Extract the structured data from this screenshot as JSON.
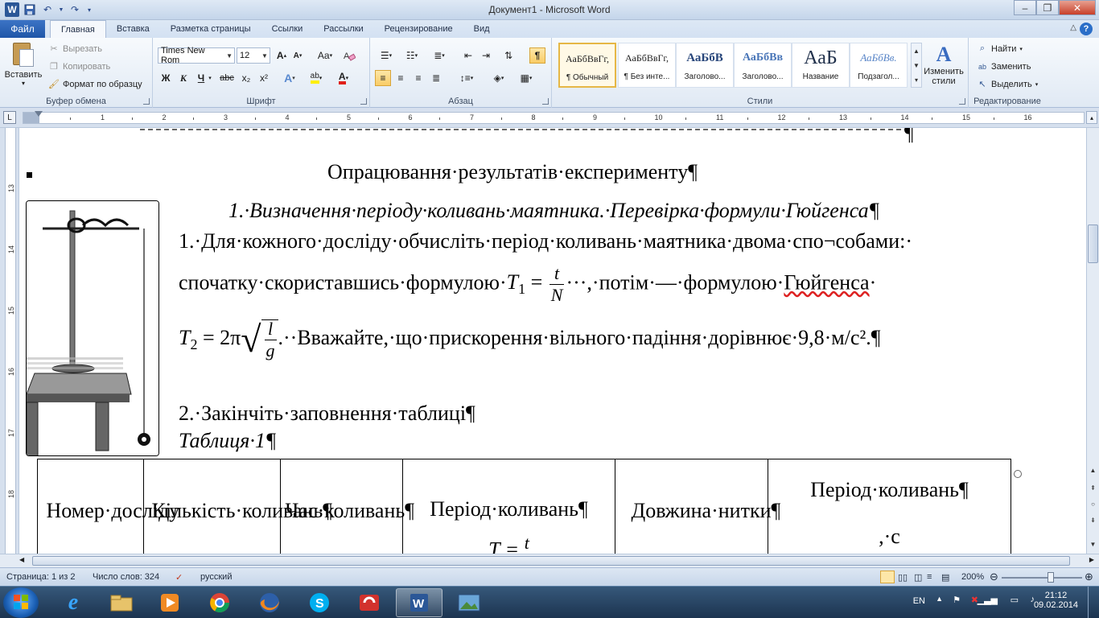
{
  "window": {
    "title": "Документ1 - Microsoft Word"
  },
  "tabs": {
    "file": "Файл",
    "items": [
      "Главная",
      "Вставка",
      "Разметка страницы",
      "Ссылки",
      "Рассылки",
      "Рецензирование",
      "Вид"
    ]
  },
  "clipboard": {
    "paste": "Вставить",
    "cut": "Вырезать",
    "copy": "Копировать",
    "format_painter": "Формат по образцу",
    "label": "Буфер обмена"
  },
  "font": {
    "name": "Times New Rom",
    "size": "12",
    "label": "Шрифт",
    "bold": "Ж",
    "italic": "К",
    "underline": "Ч",
    "strike": "abc",
    "sub": "x₂",
    "sup": "x²",
    "grow": "A",
    "shrink": "A",
    "case": "Aa",
    "highlight": "ab",
    "color": "A"
  },
  "paragraph": {
    "label": "Абзац",
    "pilcrow": "¶"
  },
  "styles": {
    "label": "Стили",
    "tiles": [
      {
        "sample": "АаБбВвГг,",
        "name": "¶ Обычный"
      },
      {
        "sample": "АаБбВвГг,",
        "name": "¶ Без инте..."
      },
      {
        "sample": "АаБбВ",
        "name": "Заголово..."
      },
      {
        "sample": "АаБбВв",
        "name": "Заголово..."
      },
      {
        "sample": "АаБ",
        "name": "Название"
      },
      {
        "sample": "АаБбВв.",
        "name": "Подзагол..."
      }
    ],
    "change": "Изменить стили"
  },
  "editing": {
    "find": "Найти",
    "replace": "Заменить",
    "select": "Выделить",
    "label": "Редактирование"
  },
  "ruler": {
    "h_numbers": [
      "1",
      "2",
      "3",
      "4",
      "5",
      "6",
      "7",
      "8",
      "9",
      "10",
      "11",
      "12",
      "13",
      "14",
      "15",
      "16"
    ],
    "v_numbers": [
      "13",
      "14",
      "15",
      "16",
      "17",
      "18"
    ]
  },
  "document": {
    "heading": "Опрацювання·результатів·експерименту¶",
    "subheading": "1.·Визначення·періоду·коливань·маятника.·Перевірка·формули·Гюйгенса¶",
    "p1": "1.·Для·кожного·досліду·обчисліть·період·коливань·маятника·двома·спо¬собами:·",
    "p2_a": "спочатку·скориставшись·формулою·",
    "p2_t1": "T",
    "p2_sub1": "1",
    "p2_eq": " = ",
    "p2_num": "t",
    "p2_den": "N",
    "p2_b": "···,·потім·—·формулою·",
    "p2_huygens": "Гюйгенса",
    "p2_c": "·",
    "p3_t2": "T",
    "p3_sub2": "2",
    "p3_eq": " = 2π",
    "p3_num": "l",
    "p3_den": "g",
    "p3_b": ".··Вважайте,·що·прискорення·вільного·падіння·дорівнює·9,8·м/с².¶",
    "p4": "2.·Закінчіть·заповнення·таблиці¶",
    "p5": "Таблиця·1¶",
    "table": {
      "headers": [
        "Номер·досліду",
        "Кількість·коливань¶",
        "Час·коливань¶",
        "Період·коливань¶",
        "Довжина·нитки¶",
        "Період·коливань¶"
      ],
      "h6_extra": ",·с",
      "h4_extra_t": "T",
      "h4_extra_frac": "t"
    }
  },
  "status": {
    "page": "Страница: 1 из 2",
    "words": "Число слов: 324",
    "lang": "русский",
    "zoom": "200%"
  },
  "taskbar": {
    "lang": "EN",
    "time": "21:12",
    "date": "09.02.2014"
  },
  "colors": {
    "accent": "#2b5797",
    "file_tab": "#2a62b5",
    "ribbon_bg": "#e0e9f4"
  }
}
